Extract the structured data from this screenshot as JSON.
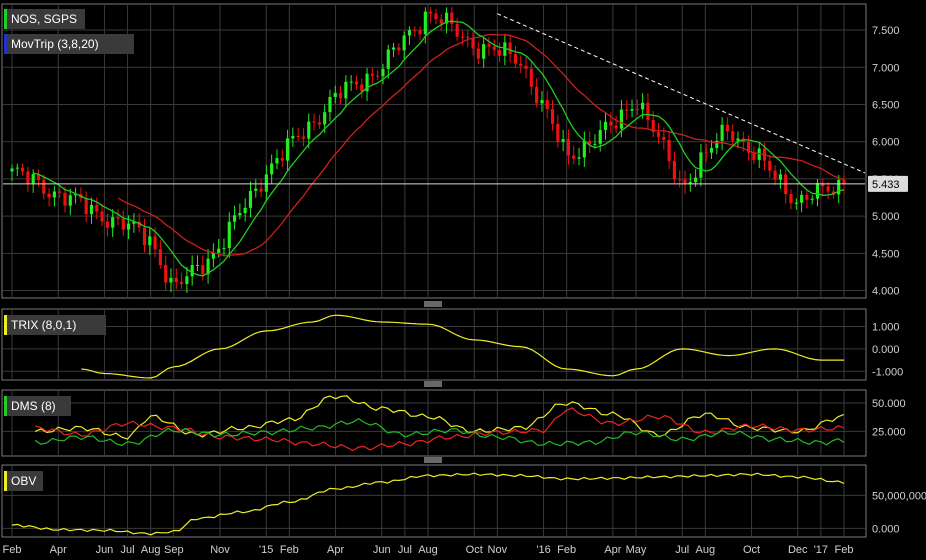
{
  "chart_data": [
    {
      "type": "candlestick",
      "panel": "price",
      "legend": [
        {
          "label": "NOS, SGPS",
          "color": "#1fd11f"
        },
        {
          "label": "MovTrip (3,8,20)",
          "color": "#2233cc"
        }
      ],
      "ylim": [
        3.9,
        7.85
      ],
      "yticks": [
        "4.000",
        "4.500",
        "5.000",
        "5.500",
        "6.000",
        "6.500",
        "7.000",
        "7.500"
      ],
      "last_price": "5.433",
      "last_value": 5.433,
      "key_points": [
        {
          "x": "2014-02",
          "y": 5.6
        },
        {
          "x": "2014-04",
          "y": 5.3
        },
        {
          "x": "2014-06",
          "y": 5.0
        },
        {
          "x": "2014-08",
          "y": 4.7
        },
        {
          "x": "2014-09",
          "y": 4.0
        },
        {
          "x": "2014-11",
          "y": 4.6
        },
        {
          "x": "2015-01",
          "y": 5.6
        },
        {
          "x": "2015-04",
          "y": 6.6
        },
        {
          "x": "2015-06",
          "y": 7.0
        },
        {
          "x": "2015-08",
          "y": 7.75
        },
        {
          "x": "2015-10",
          "y": 7.3
        },
        {
          "x": "2015-12",
          "y": 7.1
        },
        {
          "x": "2016-02",
          "y": 5.8
        },
        {
          "x": "2016-04",
          "y": 6.2
        },
        {
          "x": "2016-05",
          "y": 6.6
        },
        {
          "x": "2016-07",
          "y": 5.4
        },
        {
          "x": "2016-09",
          "y": 6.2
        },
        {
          "x": "2016-12",
          "y": 5.2
        },
        {
          "x": "2017-02",
          "y": 5.433
        }
      ],
      "ma_fast_color": "#22cc22",
      "ma_slow_color": "#cc1f1f",
      "trendline_color": "#ffffff",
      "up_color": "#22ee22",
      "down_color": "#ee1111"
    },
    {
      "type": "line",
      "panel": "trix",
      "legend": [
        {
          "label": "TRIX (8,0,1)",
          "color": "#eeee22"
        }
      ],
      "yticks": [
        "1.000",
        "0.000",
        "-1.000"
      ],
      "ylim": [
        -1.3,
        1.6
      ],
      "series": [
        {
          "color": "#eeee22",
          "points": [
            {
              "x": "2014-05",
              "y": -0.9
            },
            {
              "x": "2014-06",
              "y": -1.1
            },
            {
              "x": "2014-08",
              "y": -1.3
            },
            {
              "x": "2014-09",
              "y": -0.8
            },
            {
              "x": "2014-11",
              "y": 0.0
            },
            {
              "x": "2015-01",
              "y": 0.8
            },
            {
              "x": "2015-03",
              "y": 1.2
            },
            {
              "x": "2015-04",
              "y": 1.5
            },
            {
              "x": "2015-06",
              "y": 1.2
            },
            {
              "x": "2015-08",
              "y": 1.1
            },
            {
              "x": "2015-10",
              "y": 0.4
            },
            {
              "x": "2015-12",
              "y": 0.1
            },
            {
              "x": "2016-02",
              "y": -0.9
            },
            {
              "x": "2016-04",
              "y": -1.2
            },
            {
              "x": "2016-05",
              "y": -0.9
            },
            {
              "x": "2016-07",
              "y": 0.0
            },
            {
              "x": "2016-09",
              "y": -0.3
            },
            {
              "x": "2016-11",
              "y": 0.0
            },
            {
              "x": "2017-01",
              "y": -0.5
            },
            {
              "x": "2017-02",
              "y": -0.5
            }
          ]
        }
      ]
    },
    {
      "type": "line",
      "panel": "dms",
      "legend": [
        {
          "label": "DMS (8)",
          "color": "#22cc22"
        }
      ],
      "yticks": [
        "50.000",
        "25.000"
      ],
      "ylim": [
        5,
        58
      ],
      "series": [
        {
          "color": "#eeee22",
          "points": [
            {
              "x": "2014-03",
              "y": 25
            },
            {
              "x": "2014-05",
              "y": 28
            },
            {
              "x": "2014-07",
              "y": 20
            },
            {
              "x": "2014-08",
              "y": 38
            },
            {
              "x": "2014-10",
              "y": 22
            },
            {
              "x": "2014-12",
              "y": 28
            },
            {
              "x": "2015-02",
              "y": 35
            },
            {
              "x": "2015-04",
              "y": 56
            },
            {
              "x": "2015-06",
              "y": 45
            },
            {
              "x": "2015-08",
              "y": 38
            },
            {
              "x": "2015-10",
              "y": 25
            },
            {
              "x": "2015-12",
              "y": 28
            },
            {
              "x": "2016-02",
              "y": 50
            },
            {
              "x": "2016-04",
              "y": 40
            },
            {
              "x": "2016-06",
              "y": 22
            },
            {
              "x": "2016-08",
              "y": 40
            },
            {
              "x": "2016-10",
              "y": 28
            },
            {
              "x": "2016-12",
              "y": 25
            },
            {
              "x": "2017-02",
              "y": 38
            }
          ]
        },
        {
          "color": "#ee2222",
          "points": [
            {
              "x": "2014-03",
              "y": 28
            },
            {
              "x": "2014-05",
              "y": 22
            },
            {
              "x": "2014-07",
              "y": 32
            },
            {
              "x": "2014-09",
              "y": 28
            },
            {
              "x": "2014-11",
              "y": 20
            },
            {
              "x": "2015-01",
              "y": 18
            },
            {
              "x": "2015-03",
              "y": 14
            },
            {
              "x": "2015-05",
              "y": 10
            },
            {
              "x": "2015-07",
              "y": 14
            },
            {
              "x": "2015-09",
              "y": 20
            },
            {
              "x": "2015-11",
              "y": 24
            },
            {
              "x": "2016-01",
              "y": 26
            },
            {
              "x": "2016-02",
              "y": 44
            },
            {
              "x": "2016-04",
              "y": 32
            },
            {
              "x": "2016-06",
              "y": 38
            },
            {
              "x": "2016-08",
              "y": 24
            },
            {
              "x": "2016-10",
              "y": 30
            },
            {
              "x": "2016-12",
              "y": 26
            },
            {
              "x": "2017-02",
              "y": 28
            }
          ]
        },
        {
          "color": "#22bb22",
          "points": [
            {
              "x": "2014-03",
              "y": 15
            },
            {
              "x": "2014-05",
              "y": 20
            },
            {
              "x": "2014-07",
              "y": 14
            },
            {
              "x": "2014-09",
              "y": 26
            },
            {
              "x": "2014-11",
              "y": 22
            },
            {
              "x": "2015-01",
              "y": 24
            },
            {
              "x": "2015-03",
              "y": 28
            },
            {
              "x": "2015-05",
              "y": 34
            },
            {
              "x": "2015-07",
              "y": 22
            },
            {
              "x": "2015-09",
              "y": 26
            },
            {
              "x": "2015-11",
              "y": 20
            },
            {
              "x": "2016-01",
              "y": 14
            },
            {
              "x": "2016-03",
              "y": 15
            },
            {
              "x": "2016-05",
              "y": 24
            },
            {
              "x": "2016-07",
              "y": 18
            },
            {
              "x": "2016-09",
              "y": 24
            },
            {
              "x": "2016-11",
              "y": 18
            },
            {
              "x": "2017-01",
              "y": 15
            },
            {
              "x": "2017-02",
              "y": 17
            }
          ]
        }
      ]
    },
    {
      "type": "line",
      "panel": "obv",
      "legend": [
        {
          "label": "OBV",
          "color": "#eeee22"
        }
      ],
      "yticks": [
        "50,000,000",
        "0.000"
      ],
      "ylim": [
        -10000000,
        90000000
      ],
      "series": [
        {
          "color": "#eeee22",
          "points": [
            {
              "x": "2014-02",
              "y": 5000000
            },
            {
              "x": "2014-04",
              "y": -2000000
            },
            {
              "x": "2014-06",
              "y": -3000000
            },
            {
              "x": "2014-08",
              "y": -8000000
            },
            {
              "x": "2014-09",
              "y": -5000000
            },
            {
              "x": "2014-10",
              "y": 15000000
            },
            {
              "x": "2014-12",
              "y": 25000000
            },
            {
              "x": "2015-02",
              "y": 40000000
            },
            {
              "x": "2015-04",
              "y": 60000000
            },
            {
              "x": "2015-06",
              "y": 70000000
            },
            {
              "x": "2015-08",
              "y": 80000000
            },
            {
              "x": "2015-10",
              "y": 82000000
            },
            {
              "x": "2015-12",
              "y": 80000000
            },
            {
              "x": "2016-02",
              "y": 75000000
            },
            {
              "x": "2016-04",
              "y": 76000000
            },
            {
              "x": "2016-06",
              "y": 78000000
            },
            {
              "x": "2016-08",
              "y": 80000000
            },
            {
              "x": "2016-10",
              "y": 82000000
            },
            {
              "x": "2016-12",
              "y": 78000000
            },
            {
              "x": "2017-02",
              "y": 70000000
            }
          ]
        }
      ]
    }
  ],
  "x_axis": {
    "start": "2014-02",
    "end": "2017-02",
    "labels": [
      {
        "text": "Feb",
        "date": "2014-02"
      },
      {
        "text": "Apr",
        "date": "2014-04"
      },
      {
        "text": "Jun",
        "date": "2014-06"
      },
      {
        "text": "Jul",
        "date": "2014-07"
      },
      {
        "text": "Aug",
        "date": "2014-08"
      },
      {
        "text": "Sep",
        "date": "2014-09"
      },
      {
        "text": "Nov",
        "date": "2014-11"
      },
      {
        "text": "'15",
        "date": "2015-01"
      },
      {
        "text": "Feb",
        "date": "2015-02"
      },
      {
        "text": "Apr",
        "date": "2015-04"
      },
      {
        "text": "Jun",
        "date": "2015-06"
      },
      {
        "text": "Jul",
        "date": "2015-07"
      },
      {
        "text": "Aug",
        "date": "2015-08"
      },
      {
        "text": "Oct",
        "date": "2015-10"
      },
      {
        "text": "Nov",
        "date": "2015-11"
      },
      {
        "text": "'16",
        "date": "2016-01"
      },
      {
        "text": "Feb",
        "date": "2016-02"
      },
      {
        "text": "Apr",
        "date": "2016-04"
      },
      {
        "text": "May",
        "date": "2016-05"
      },
      {
        "text": "Jul",
        "date": "2016-07"
      },
      {
        "text": "Aug",
        "date": "2016-08"
      },
      {
        "text": "Oct",
        "date": "2016-10"
      },
      {
        "text": "Dec",
        "date": "2016-12"
      },
      {
        "text": "'17",
        "date": "2017-01"
      },
      {
        "text": "Feb",
        "date": "2017-02"
      }
    ]
  },
  "colors": {
    "background": "#000000",
    "panel_border": "#7a7a7a",
    "grid": "#3a3a3a",
    "axis_text": "#d0d0d0",
    "legend_bg": "#3a3a3a"
  }
}
